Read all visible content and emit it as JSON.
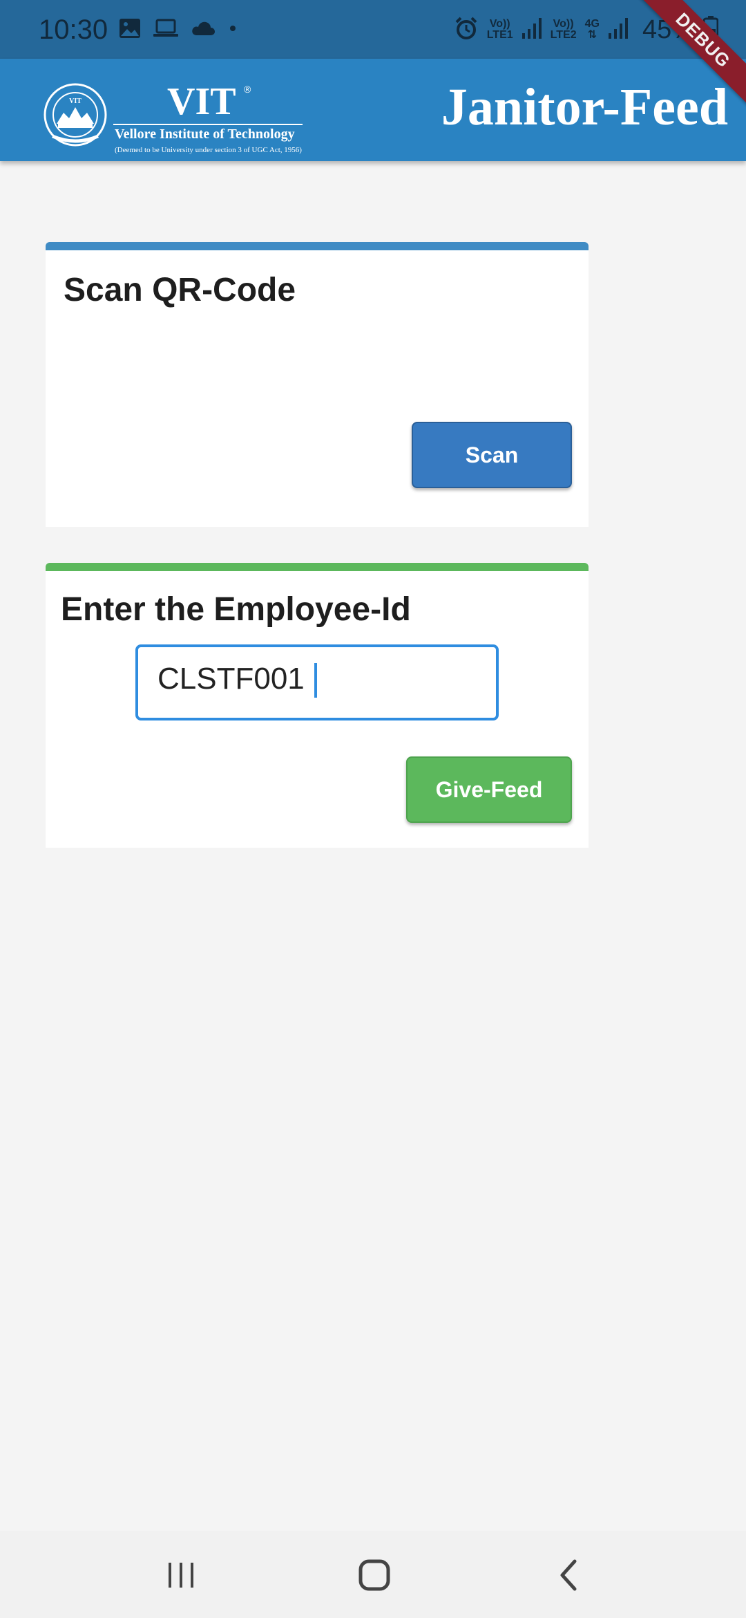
{
  "status_bar": {
    "time": "10:30",
    "sim1_label_top": "Vo))",
    "sim1_label_bottom": "LTE1",
    "sim2_label_top": "Vo))",
    "sim2_label_bottom": "LTE2",
    "network_label": "4G",
    "battery": "45%"
  },
  "debug_banner": "DEBUG",
  "app_bar": {
    "logo_title": "VIT",
    "logo_registered": "®",
    "logo_name": "Vellore Institute of Technology",
    "logo_subtitle": "(Deemed to be University under section 3 of UGC Act, 1956)",
    "seal_text": "VIT",
    "title": "Janitor-Feed"
  },
  "scan_card": {
    "title": "Scan QR-Code",
    "button_label": "Scan"
  },
  "employee_card": {
    "title": "Enter the Employee-Id",
    "input_value": "CLSTF001",
    "button_label": "Give-Feed"
  },
  "colors": {
    "status_bar": "#25689a",
    "app_bar": "#2a83c2",
    "scan_accent": "#377ac1",
    "feed_accent": "#5cb85c",
    "input_border": "#2f8de0",
    "debug": "#8a1e2b"
  },
  "icons": {
    "status_left": [
      "image-icon",
      "laptop-icon",
      "cloud-icon",
      "dot-icon"
    ],
    "status_right": [
      "alarm-icon",
      "signal-icon",
      "battery-icon"
    ],
    "nav": [
      "recents-icon",
      "home-icon",
      "back-icon"
    ]
  }
}
